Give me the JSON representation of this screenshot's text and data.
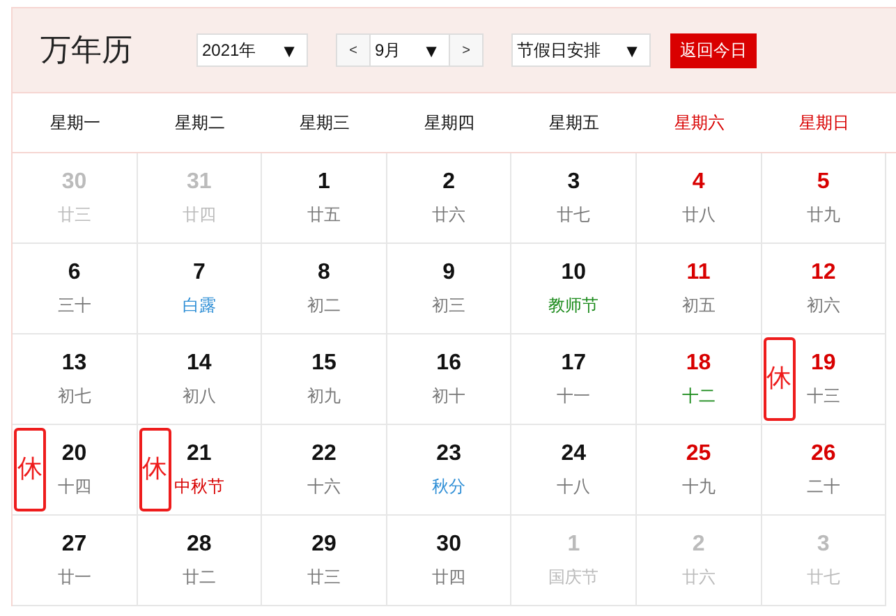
{
  "title": "万年历",
  "controls": {
    "year": "2021年",
    "prev": "<",
    "month": "9月",
    "next": ">",
    "holiday": "节假日安排",
    "arrow": "▼",
    "today": "返回今日"
  },
  "weekdays": [
    {
      "label": "星期一",
      "weekend": false
    },
    {
      "label": "星期二",
      "weekend": false
    },
    {
      "label": "星期三",
      "weekend": false
    },
    {
      "label": "星期四",
      "weekend": false
    },
    {
      "label": "星期五",
      "weekend": false
    },
    {
      "label": "星期六",
      "weekend": true
    },
    {
      "label": "星期日",
      "weekend": true
    }
  ],
  "weeks": [
    [
      {
        "day": "30",
        "lunar": {
          "text": "廿三",
          "color": "#bbbbbb"
        },
        "other_month": true
      },
      {
        "day": "31",
        "lunar": {
          "text": "廿四",
          "color": "#bbbbbb"
        },
        "other_month": true
      },
      {
        "day": "1",
        "lunar": {
          "text": "廿五",
          "color": "#777777"
        },
        "other_month": false,
        "weekend": false
      },
      {
        "day": "2",
        "lunar": {
          "text": "廿六",
          "color": "#777777"
        },
        "other_month": false,
        "weekend": false
      },
      {
        "day": "3",
        "lunar": {
          "text": "廿七",
          "color": "#777777"
        },
        "other_month": false,
        "weekend": false
      },
      {
        "day": "4",
        "lunar": {
          "text": "廿八",
          "color": "#777777"
        },
        "other_month": false,
        "weekend": true
      },
      {
        "day": "5",
        "lunar": {
          "text": "廿九",
          "color": "#777777"
        },
        "other_month": false,
        "weekend": true
      }
    ],
    [
      {
        "day": "6",
        "lunar": {
          "text": "三十",
          "color": "#777777"
        },
        "other_month": false,
        "weekend": false
      },
      {
        "day": "7",
        "lunar": {
          "text": "白露",
          "color": "#2f8fd6"
        },
        "other_month": false,
        "weekend": false
      },
      {
        "day": "8",
        "lunar": {
          "text": "初二",
          "color": "#777777"
        },
        "other_month": false,
        "weekend": false
      },
      {
        "day": "9",
        "lunar": {
          "text": "初三",
          "color": "#777777"
        },
        "other_month": false,
        "weekend": false
      },
      {
        "day": "10",
        "lunar": {
          "text": "教师节",
          "color": "#1a8a1a"
        },
        "other_month": false,
        "weekend": false
      },
      {
        "day": "11",
        "lunar": {
          "text": "初五",
          "color": "#777777"
        },
        "other_month": false,
        "weekend": true
      },
      {
        "day": "12",
        "lunar": {
          "text": "初六",
          "color": "#777777"
        },
        "other_month": false,
        "weekend": true
      }
    ],
    [
      {
        "day": "13",
        "lunar": {
          "text": "初七",
          "color": "#777777"
        },
        "other_month": false,
        "weekend": false
      },
      {
        "day": "14",
        "lunar": {
          "text": "初八",
          "color": "#777777"
        },
        "other_month": false,
        "weekend": false
      },
      {
        "day": "15",
        "lunar": {
          "text": "初九",
          "color": "#777777"
        },
        "other_month": false,
        "weekend": false
      },
      {
        "day": "16",
        "lunar": {
          "text": "初十",
          "color": "#777777"
        },
        "other_month": false,
        "weekend": false
      },
      {
        "day": "17",
        "lunar": {
          "text": "十一",
          "color": "#777777"
        },
        "other_month": false,
        "weekend": false
      },
      {
        "day": "18",
        "lunar": {
          "text": "十二",
          "color": "#1a8a1a"
        },
        "other_month": false,
        "weekend": true
      },
      {
        "day": "19",
        "lunar": {
          "text": "十三",
          "color": "#777777"
        },
        "other_month": false,
        "weekend": true,
        "annotation": "休"
      }
    ],
    [
      {
        "day": "20",
        "lunar": {
          "text": "十四",
          "color": "#777777"
        },
        "other_month": false,
        "weekend": false,
        "annotation": "休"
      },
      {
        "day": "21",
        "lunar": {
          "text": "中秋节",
          "color": "#d80000"
        },
        "other_month": false,
        "weekend": false,
        "annotation": "休"
      },
      {
        "day": "22",
        "lunar": {
          "text": "十六",
          "color": "#777777"
        },
        "other_month": false,
        "weekend": false
      },
      {
        "day": "23",
        "lunar": {
          "text": "秋分",
          "color": "#2f8fd6"
        },
        "other_month": false,
        "weekend": false
      },
      {
        "day": "24",
        "lunar": {
          "text": "十八",
          "color": "#777777"
        },
        "other_month": false,
        "weekend": false
      },
      {
        "day": "25",
        "lunar": {
          "text": "十九",
          "color": "#777777"
        },
        "other_month": false,
        "weekend": true
      },
      {
        "day": "26",
        "lunar": {
          "text": "二十",
          "color": "#777777"
        },
        "other_month": false,
        "weekend": true
      }
    ],
    [
      {
        "day": "27",
        "lunar": {
          "text": "廿一",
          "color": "#777777"
        },
        "other_month": false,
        "weekend": false
      },
      {
        "day": "28",
        "lunar": {
          "text": "廿二",
          "color": "#777777"
        },
        "other_month": false,
        "weekend": false
      },
      {
        "day": "29",
        "lunar": {
          "text": "廿三",
          "color": "#777777"
        },
        "other_month": false,
        "weekend": false
      },
      {
        "day": "30",
        "lunar": {
          "text": "廿四",
          "color": "#777777"
        },
        "other_month": false,
        "weekend": false
      },
      {
        "day": "1",
        "lunar": {
          "text": "国庆节",
          "color": "#bbbbbb"
        },
        "other_month": true
      },
      {
        "day": "2",
        "lunar": {
          "text": "廿六",
          "color": "#bbbbbb"
        },
        "other_month": true
      },
      {
        "day": "3",
        "lunar": {
          "text": "廿七",
          "color": "#bbbbbb"
        },
        "other_month": true
      }
    ]
  ]
}
